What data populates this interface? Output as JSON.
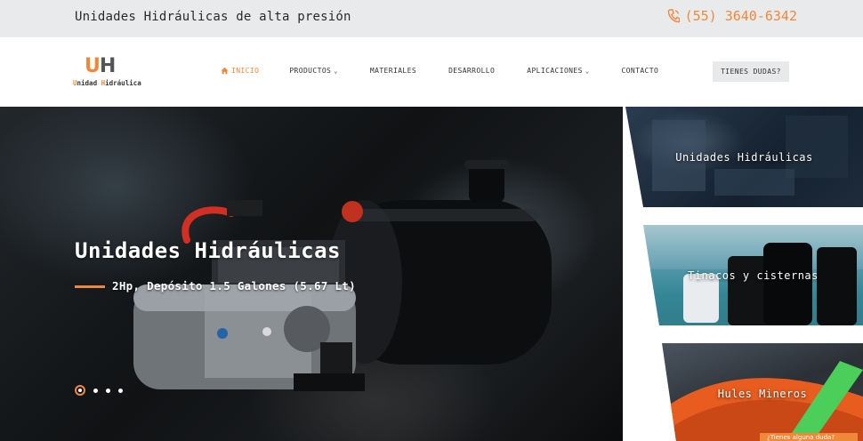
{
  "topbar": {
    "tagline": "Unidades Hidráulicas de alta presión",
    "phone": "(55) 3640-6342",
    "phone_icon": "phone-icon"
  },
  "logo": {
    "mark_u": "U",
    "mark_h": "H",
    "brand_a": "U",
    "brand_b": "nidad ",
    "brand_c": "H",
    "brand_d": "idráulica"
  },
  "nav": {
    "items": [
      {
        "label": "INICIO",
        "icon": "home-icon",
        "active": true
      },
      {
        "label": "PRODUCTOS",
        "caret": "⌄"
      },
      {
        "label": "MATERIALES"
      },
      {
        "label": "DESARROLLO"
      },
      {
        "label": "APLICACIONES",
        "caret": "⌄"
      },
      {
        "label": "CONTACTO"
      }
    ],
    "cta": "TIENES DUDAS?"
  },
  "hero": {
    "title": "Unidades Hidráulicas",
    "subtitle": "2Hp, Depósito 1.5 Galones (5.67 Lt)",
    "slide_count": 4,
    "active_slide": 1
  },
  "panels": [
    {
      "label": "Unidades Hidráulicas"
    },
    {
      "label": "Tinacos y cisternas"
    },
    {
      "label": "Hules Mineros"
    }
  ],
  "chat": {
    "label": "¿Tienes alguna duda?"
  },
  "colors": {
    "accent": "#f0883a",
    "topbar_bg": "#e9eaec",
    "text_dark": "#2a2a2a"
  }
}
